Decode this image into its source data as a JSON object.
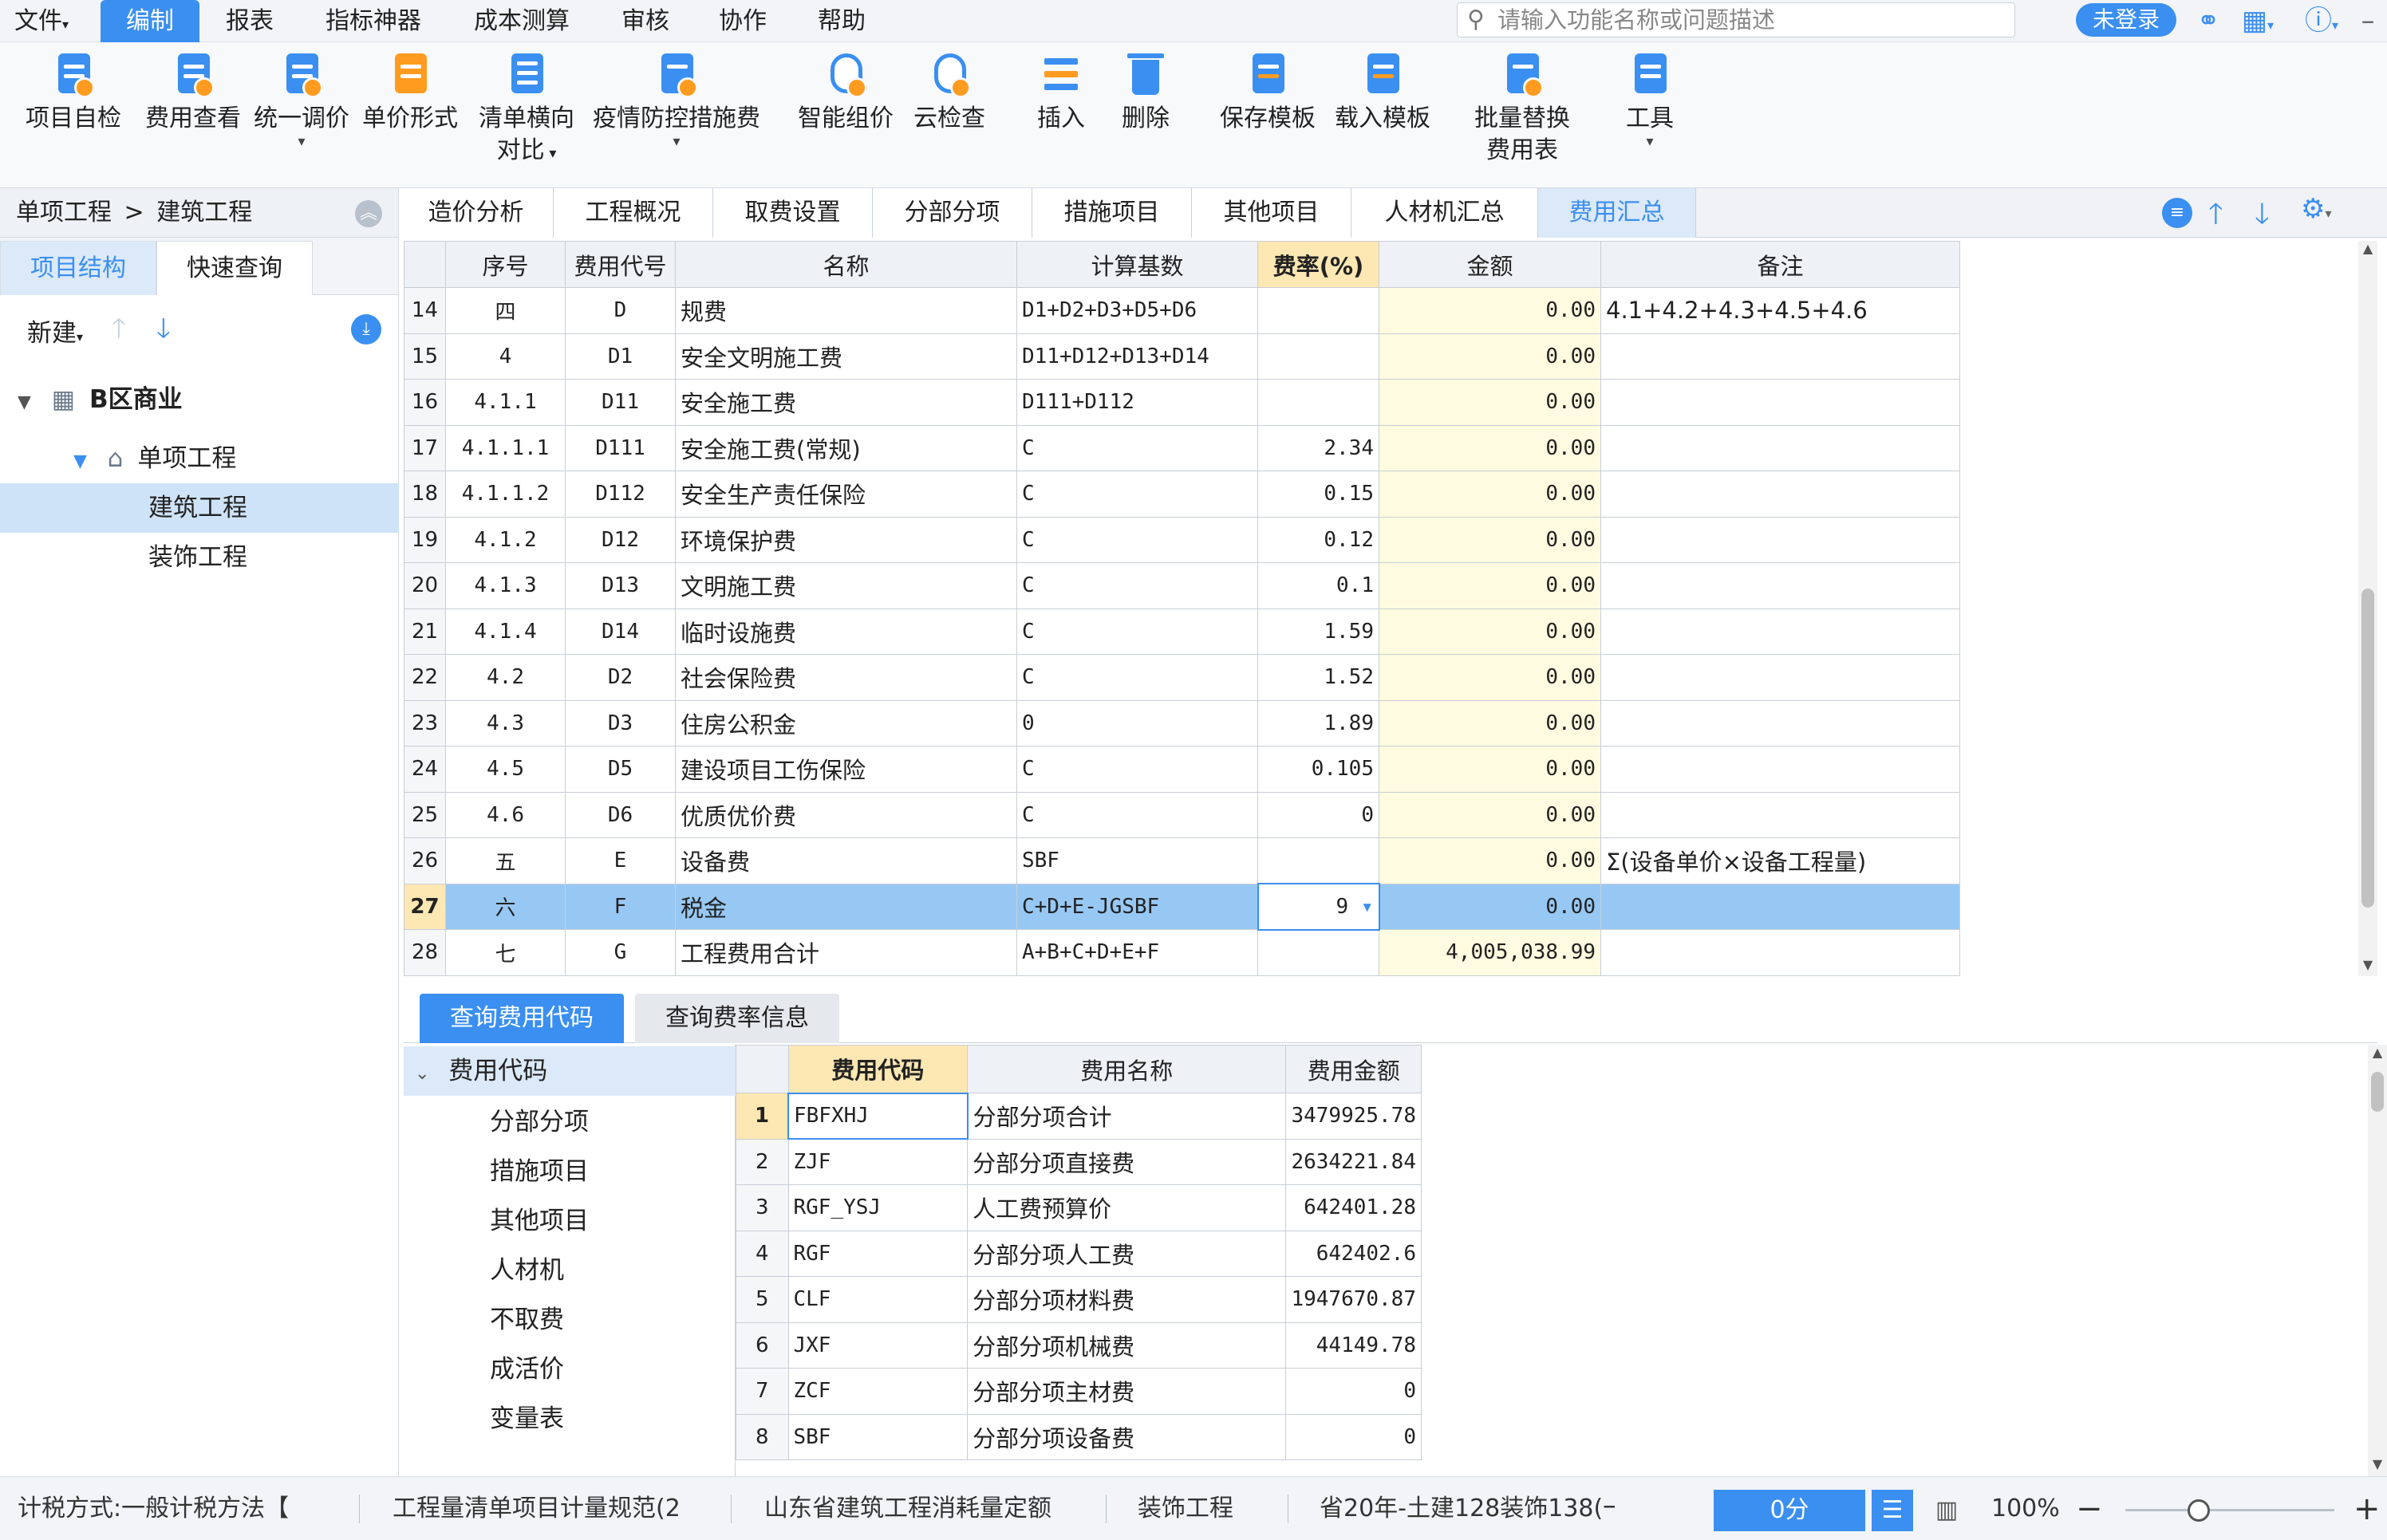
{
  "menubar": {
    "items": [
      "文件",
      "编制",
      "报表",
      "指标神器",
      "成本测算",
      "审核",
      "协作",
      "帮助"
    ],
    "active": "编制",
    "search_placeholder": "请输入功能名称或问题描述",
    "login_label": "未登录"
  },
  "ribbon": {
    "tools": [
      {
        "label": "项目自检",
        "icon": "check-doc-icon"
      },
      {
        "label": "费用查看",
        "icon": "fee-view-icon"
      },
      {
        "label": "统一调价",
        "icon": "adjust-price-icon"
      },
      {
        "label": "单价形式",
        "icon": "unit-price-icon"
      },
      {
        "label": "清单横向",
        "label2": "对比",
        "icon": "compare-icon"
      },
      {
        "label": "疫情防控措施费",
        "icon": "epidemic-icon"
      },
      {
        "label": "智能组价",
        "icon": "smart-price-icon"
      },
      {
        "label": "云检查",
        "icon": "cloud-check-icon"
      },
      {
        "label": "插入",
        "icon": "insert-icon"
      },
      {
        "label": "删除",
        "icon": "delete-icon"
      },
      {
        "label": "保存模板",
        "icon": "save-template-icon"
      },
      {
        "label": "载入模板",
        "icon": "load-template-icon"
      },
      {
        "label": "批量替换",
        "label2": "费用表",
        "icon": "batch-replace-icon"
      },
      {
        "label": "工具",
        "icon": "tools-icon"
      }
    ]
  },
  "breadcrumb": {
    "parent": "单项工程",
    "separator": ">",
    "current": "建筑工程"
  },
  "left_tabs": [
    "项目结构",
    "快速查询"
  ],
  "new_label": "新建",
  "tree": [
    {
      "label": "B区商业",
      "level": 0
    },
    {
      "label": "单项工程",
      "level": 1
    },
    {
      "label": "建筑工程",
      "level": 2
    },
    {
      "label": "装饰工程",
      "level": 2
    }
  ],
  "main_tabs": [
    "造价分析",
    "工程概况",
    "取费设置",
    "分部分项",
    "措施项目",
    "其他项目",
    "人材机汇总",
    "费用汇总"
  ],
  "fee_table": {
    "headers": [
      "",
      "序号",
      "费用代号",
      "名称",
      "计算基数",
      "费率(%)",
      "金额",
      "备注"
    ],
    "rows": [
      {
        "rn": "14",
        "seq": "四",
        "code": "D",
        "name": "规费",
        "base": "D1+D2+D3+D5+D6",
        "rate": "",
        "amount": "0.00",
        "note": "4.1+4.2+4.3+4.5+4.6"
      },
      {
        "rn": "15",
        "seq": "4",
        "code": "D1",
        "name": "安全文明施工费",
        "base": "D11+D12+D13+D14",
        "rate": "",
        "amount": "0.00",
        "note": ""
      },
      {
        "rn": "16",
        "seq": "4.1.1",
        "code": "D11",
        "name": "安全施工费",
        "base": "D111+D112",
        "rate": "",
        "amount": "0.00",
        "note": ""
      },
      {
        "rn": "17",
        "seq": "4.1.1.1",
        "code": "D111",
        "name": "安全施工费(常规)",
        "base": "C",
        "rate": "2.34",
        "amount": "0.00",
        "note": ""
      },
      {
        "rn": "18",
        "seq": "4.1.1.2",
        "code": "D112",
        "name": "安全生产责任保险",
        "base": "C",
        "rate": "0.15",
        "amount": "0.00",
        "note": ""
      },
      {
        "rn": "19",
        "seq": "4.1.2",
        "code": "D12",
        "name": "环境保护费",
        "base": "C",
        "rate": "0.12",
        "amount": "0.00",
        "note": ""
      },
      {
        "rn": "20",
        "seq": "4.1.3",
        "code": "D13",
        "name": "文明施工费",
        "base": "C",
        "rate": "0.1",
        "amount": "0.00",
        "note": ""
      },
      {
        "rn": "21",
        "seq": "4.1.4",
        "code": "D14",
        "name": "临时设施费",
        "base": "C",
        "rate": "1.59",
        "amount": "0.00",
        "note": ""
      },
      {
        "rn": "22",
        "seq": "4.2",
        "code": "D2",
        "name": "社会保险费",
        "base": "C",
        "rate": "1.52",
        "amount": "0.00",
        "note": ""
      },
      {
        "rn": "23",
        "seq": "4.3",
        "code": "D3",
        "name": "住房公积金",
        "base": "0",
        "rate": "1.89",
        "amount": "0.00",
        "note": ""
      },
      {
        "rn": "24",
        "seq": "4.5",
        "code": "D5",
        "name": "建设项目工伤保险",
        "base": "C",
        "rate": "0.105",
        "amount": "0.00",
        "note": ""
      },
      {
        "rn": "25",
        "seq": "4.6",
        "code": "D6",
        "name": "优质优价费",
        "base": "C",
        "rate": "0",
        "amount": "0.00",
        "note": ""
      },
      {
        "rn": "26",
        "seq": "五",
        "code": "E",
        "name": "设备费",
        "base": "SBF",
        "rate": "",
        "amount": "0.00",
        "note": "Σ(设备单价×设备工程量)"
      },
      {
        "rn": "27",
        "seq": "六",
        "code": "F",
        "name": "税金",
        "base": "C+D+E-JGSBF",
        "rate": "9",
        "amount": "0.00",
        "note": ""
      },
      {
        "rn": "28",
        "seq": "七",
        "code": "G",
        "name": "工程费用合计",
        "base": "A+B+C+D+E+F",
        "rate": "",
        "amount": "4,005,038.99",
        "note": ""
      }
    ],
    "selected_row": "27"
  },
  "sub_tabs": [
    "查询费用代码",
    "查询费率信息"
  ],
  "code_tree": {
    "root": "费用代码",
    "children": [
      "分部分项",
      "措施项目",
      "其他项目",
      "人材机",
      "不取费",
      "成活价",
      "变量表"
    ]
  },
  "code_table": {
    "headers": [
      "",
      "费用代码",
      "费用名称",
      "费用金额"
    ],
    "rows": [
      {
        "rn": "1",
        "code": "FBFXHJ",
        "name": "分部分项合计",
        "amount": "3479925.78"
      },
      {
        "rn": "2",
        "code": "ZJF",
        "name": "分部分项直接费",
        "amount": "2634221.84"
      },
      {
        "rn": "3",
        "code": "RGF_YSJ",
        "name": "人工费预算价",
        "amount": "642401.28"
      },
      {
        "rn": "4",
        "code": "RGF",
        "name": "分部分项人工费",
        "amount": "642402.6"
      },
      {
        "rn": "5",
        "code": "CLF",
        "name": "分部分项材料费",
        "amount": "1947670.87"
      },
      {
        "rn": "6",
        "code": "JXF",
        "name": "分部分项机械费",
        "amount": "44149.78"
      },
      {
        "rn": "7",
        "code": "ZCF",
        "name": "分部分项主材费",
        "amount": "0"
      },
      {
        "rn": "8",
        "code": "SBF",
        "name": "分部分项设备费",
        "amount": "0"
      }
    ]
  },
  "statusbar": {
    "tax_method": "计税方式:一般计税方法【",
    "spec": "工程量清单项目计量规范(2",
    "quota": "山东省建筑工程消耗量定额",
    "project": "装饰工程",
    "fee_std": "省20年-土建128装饰138(一",
    "score": "0分",
    "zoom": "100%"
  },
  "colors": {
    "accent": "#3a8ff0",
    "selected_row": "#97c8f4",
    "header_highlight": "#fde7b3",
    "amount_bg": "#fffbe0"
  }
}
